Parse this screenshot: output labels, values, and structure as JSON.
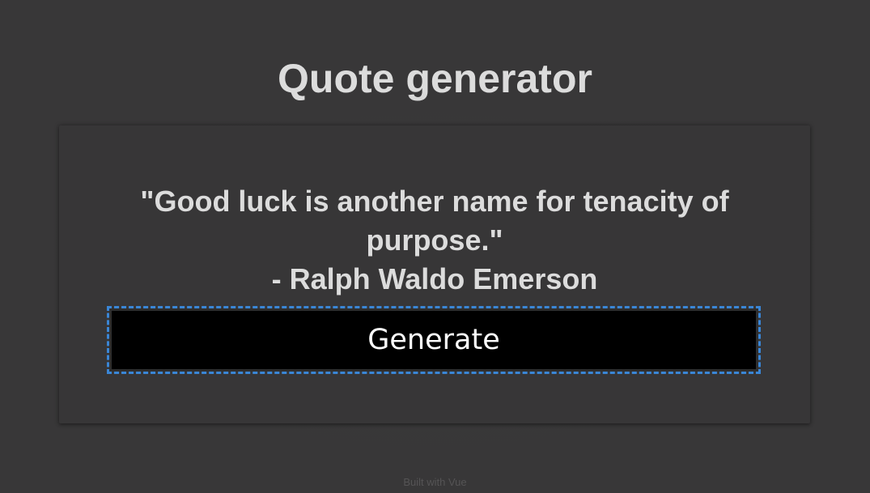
{
  "page": {
    "title": "Quote generator"
  },
  "quote": {
    "text": "\"Good luck is another name for tenacity of purpose.\"",
    "author": "- Ralph Waldo Emerson"
  },
  "actions": {
    "generate_label": "Generate"
  },
  "footer": {
    "text": "Built with Vue"
  },
  "colors": {
    "background": "#383738",
    "text": "#dcdcdc",
    "button_background": "#000000",
    "button_text": "#ffffff",
    "focus_outline": "#3a86d6"
  }
}
